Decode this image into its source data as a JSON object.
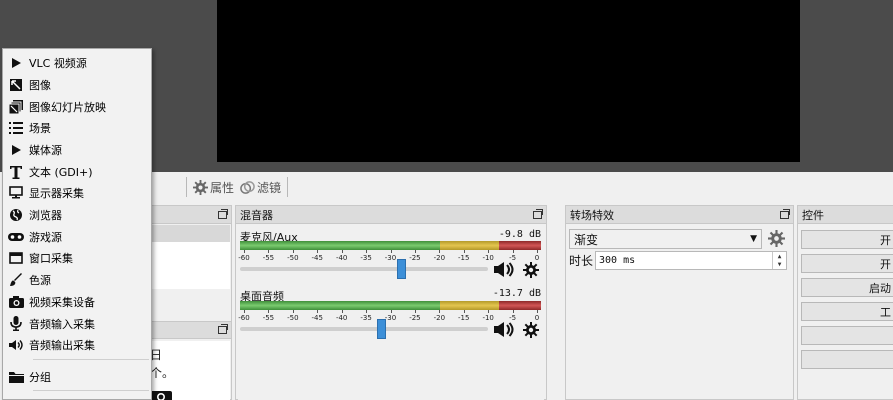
{
  "menu": {
    "items": [
      {
        "label": "VLC 视频源",
        "icon": "play-icon"
      },
      {
        "label": "图像",
        "icon": "image-icon"
      },
      {
        "label": "图像幻灯片放映",
        "icon": "slideshow-icon"
      },
      {
        "label": "场景",
        "icon": "list-icon"
      },
      {
        "label": "媒体源",
        "icon": "play-icon"
      },
      {
        "label": "文本 (GDI+)",
        "icon": "text-icon"
      },
      {
        "label": "显示器采集",
        "icon": "monitor-icon"
      },
      {
        "label": "浏览器",
        "icon": "globe-icon"
      },
      {
        "label": "游戏源",
        "icon": "gamepad-icon"
      },
      {
        "label": "窗口采集",
        "icon": "window-icon"
      },
      {
        "label": "色源",
        "icon": "brush-icon"
      },
      {
        "label": "视频采集设备",
        "icon": "camera-icon"
      },
      {
        "label": "音频输入采集",
        "icon": "microphone-icon"
      },
      {
        "label": "音频输出采集",
        "icon": "speaker-icon"
      }
    ],
    "group_label": "分组",
    "group_icon": "folder-icon"
  },
  "toolbar": {
    "properties_label": "属性",
    "filters_label": "滤镜"
  },
  "sources_fragments": [
    "日",
    "个。"
  ],
  "mixer": {
    "title": "混音器",
    "channels": [
      {
        "name": "麦克风/Aux",
        "db": "-9.8 dB",
        "volume": 0.65
      },
      {
        "name": "桌面音频",
        "db": "-13.7 dB",
        "volume": 0.57
      }
    ],
    "ticks": [
      "-60",
      "-55",
      "-50",
      "-45",
      "-40",
      "-35",
      "-30",
      "-25",
      "-20",
      "-15",
      "-10",
      "-5",
      "0"
    ]
  },
  "transitions": {
    "title": "转场特效",
    "selected": "渐变",
    "duration_label": "时长",
    "duration_value": "300 ms"
  },
  "controls": {
    "title": "控件",
    "buttons": [
      "开",
      "开",
      "启动",
      "工",
      "",
      ""
    ]
  },
  "colors": {
    "meter_green": "#5fb554",
    "meter_yellow": "#d8b940",
    "meter_red": "#c64343",
    "slider": "#3c8fd8"
  }
}
